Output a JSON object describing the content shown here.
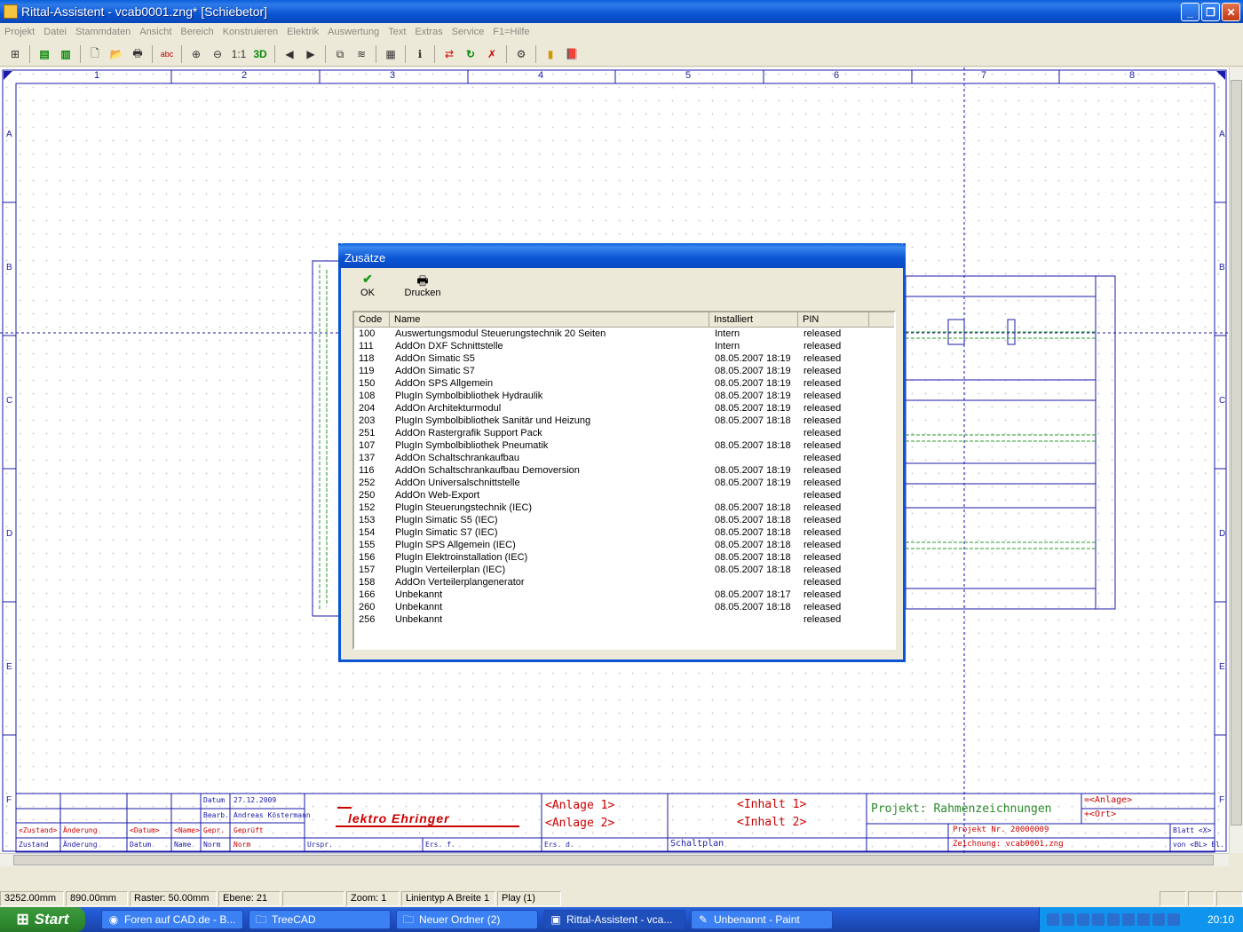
{
  "window": {
    "title": "Rittal-Assistent - vcab0001.zng* [Schiebetor]"
  },
  "menu": [
    "Projekt",
    "Datei",
    "Stammdaten",
    "Ansicht",
    "Bereich",
    "Konstruieren",
    "Elektrik",
    "Auswertung",
    "Text",
    "Extras",
    "Service",
    "F1=Hilfe"
  ],
  "toolbar": {
    "zoom_11": "1:1",
    "threed": "3D"
  },
  "grid": {
    "columns": [
      "1",
      "2",
      "3",
      "4",
      "5",
      "6",
      "7",
      "8"
    ],
    "rows": [
      "A",
      "B",
      "C",
      "D",
      "E",
      "F"
    ]
  },
  "titleblock": {
    "datum_label": "Datum",
    "datum_value": "27.12.2009",
    "bearb_label": "Bearb.",
    "bearb_value": "Andreas Köstermann",
    "gepr_label": "Gepr.",
    "gepr_value": "Geprüft",
    "zustand_ph": "<Zustand>",
    "aenderung1": "Änderung",
    "datum_ph": "<Datum>",
    "name_ph": "<Name>",
    "zustand": "Zustand",
    "aenderung2": "Änderung",
    "datum2": "Datum",
    "name2": "Name",
    "norm1": "Norm",
    "norm2": "Norm",
    "urspr": "Urspr.",
    "ersf": "Ers. f.",
    "ersd": "Ers. d.",
    "company": "lektro Ehringer",
    "anlage1": "<Anlage 1>",
    "anlage2": "<Anlage 2>",
    "inhalt1": "<Inhalt 1>",
    "inhalt2": "<Inhalt 2>",
    "schaltplan": "Schaltplan",
    "projekt": "Projekt: Rahmenzeichnungen",
    "anlage_ref": "=<Anlage>",
    "ort_ref": "+<Ort>",
    "projekt_nr": "Projekt Nr. 20000009",
    "zeichnung": "Zeichnung:  vcab0001.zng",
    "blatt": "Blatt <X>",
    "von": "von <BL> Bl."
  },
  "dialog": {
    "title": "Zusätze",
    "ok_label": "OK",
    "print_label": "Drucken",
    "columns": [
      "Code",
      "Name",
      "Installiert",
      "PIN"
    ],
    "rows": [
      [
        "100",
        "Auswertungsmodul Steuerungstechnik 20 Seiten",
        "Intern",
        "released"
      ],
      [
        "111",
        "AddOn DXF Schnittstelle",
        "Intern",
        "released"
      ],
      [
        "118",
        "AddOn Simatic S5",
        "08.05.2007 18:19",
        "released"
      ],
      [
        "119",
        "AddOn Simatic S7",
        "08.05.2007 18:19",
        "released"
      ],
      [
        "150",
        "AddOn SPS Allgemein",
        "08.05.2007 18:19",
        "released"
      ],
      [
        "108",
        "PlugIn Symbolbibliothek Hydraulik",
        "08.05.2007 18:19",
        "released"
      ],
      [
        "204",
        "AddOn Architekturmodul",
        "08.05.2007 18:19",
        "released"
      ],
      [
        "203",
        "PlugIn Symbolbibliothek Sanitär und Heizung",
        "08.05.2007 18:18",
        "released"
      ],
      [
        "251",
        "AddOn Rastergrafik Support Pack",
        "",
        "released"
      ],
      [
        "107",
        "PlugIn Symbolbibliothek Pneumatik",
        "08.05.2007 18:18",
        "released"
      ],
      [
        "137",
        "AddOn Schaltschrankaufbau",
        "",
        "released"
      ],
      [
        "116",
        "AddOn Schaltschrankaufbau Demoversion",
        "08.05.2007 18:19",
        "released"
      ],
      [
        "252",
        "AddOn Universalschnittstelle",
        "08.05.2007 18:19",
        "released"
      ],
      [
        "250",
        "AddOn Web-Export",
        "",
        "released"
      ],
      [
        "152",
        "PlugIn Steuerungstechnik (IEC)",
        "08.05.2007 18:18",
        "released"
      ],
      [
        "153",
        "PlugIn Simatic S5 (IEC)",
        "08.05.2007 18:18",
        "released"
      ],
      [
        "154",
        "PlugIn Simatic S7 (IEC)",
        "08.05.2007 18:18",
        "released"
      ],
      [
        "155",
        "PlugIn SPS Allgemein (IEC)",
        "08.05.2007 18:18",
        "released"
      ],
      [
        "156",
        "PlugIn Elektroinstallation (IEC)",
        "08.05.2007 18:18",
        "released"
      ],
      [
        "157",
        "PlugIn Verteilerplan (IEC)",
        "08.05.2007 18:18",
        "released"
      ],
      [
        "158",
        "AddOn Verteilerplangenerator",
        "",
        "released"
      ],
      [
        "166",
        "Unbekannt",
        "08.05.2007 18:17",
        "released"
      ],
      [
        "260",
        "Unbekannt",
        "08.05.2007 18:18",
        "released"
      ],
      [
        "256",
        "Unbekannt",
        "",
        "released"
      ]
    ]
  },
  "status": [
    "3252.00mm",
    "890.00mm",
    "Raster: 50.00mm",
    "Ebene: 21",
    "",
    "Zoom: 1",
    "Linientyp A Breite 1",
    "Play (1)"
  ],
  "taskbar": {
    "start": "Start",
    "tasks": [
      "Foren auf CAD.de - B...",
      "TreeCAD",
      "Neuer Ordner (2)",
      "Rittal-Assistent - vca...",
      "Unbenannt - Paint"
    ],
    "clock": "20:10"
  }
}
